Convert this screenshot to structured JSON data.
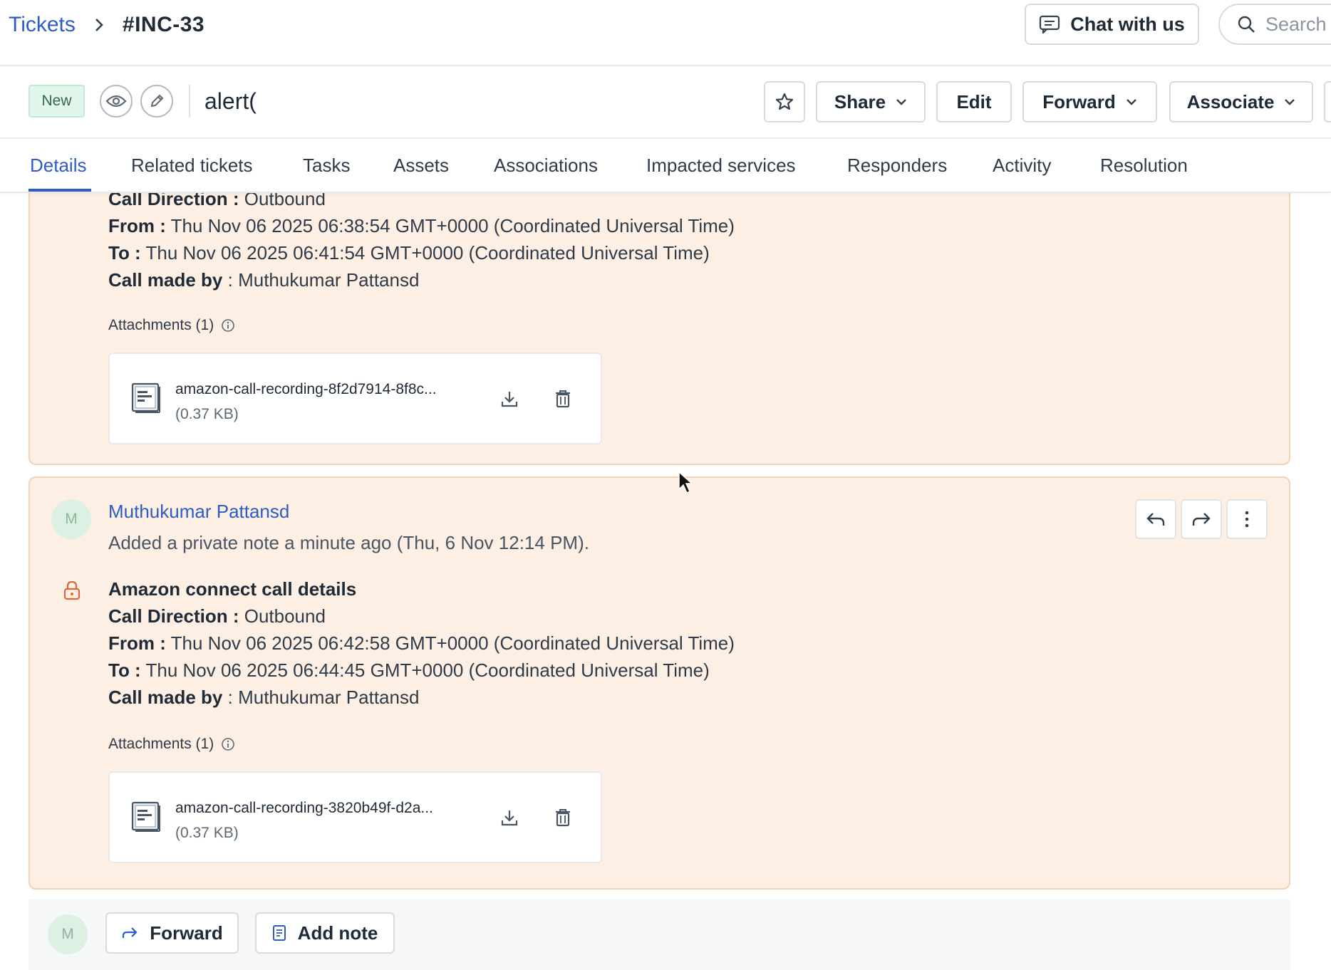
{
  "breadcrumb": {
    "root": "Tickets",
    "current": "#INC-33"
  },
  "header_actions": {
    "chat_label": "Chat with us",
    "search_placeholder": "Search"
  },
  "ticket": {
    "status": "New",
    "subject": "alert(",
    "toolbar": {
      "share": "Share",
      "edit": "Edit",
      "forward": "Forward",
      "associate": "Associate"
    }
  },
  "tabs": [
    {
      "label": "Details",
      "active": true
    },
    {
      "label": "Related tickets"
    },
    {
      "label": "Tasks"
    },
    {
      "label": "Assets"
    },
    {
      "label": "Associations"
    },
    {
      "label": "Impacted services"
    },
    {
      "label": "Responders"
    },
    {
      "label": "Activity"
    },
    {
      "label": "Resolution"
    }
  ],
  "notes": [
    {
      "call_direction_label": "Call Direction :",
      "call_direction": "Outbound",
      "from_label": "From :",
      "from": "Thu Nov 06 2025 06:38:54 GMT+0000 (Coordinated Universal Time)",
      "to_label": "To :",
      "to": "Thu Nov 06 2025 06:41:54 GMT+0000 (Coordinated Universal Time)",
      "made_by_label": "Call made by",
      "made_by": ": Muthukumar Pattansd",
      "attachments_label": "Attachments (1)",
      "attachment": {
        "name": "amazon-call-recording-8f2d7914-8f8c...",
        "size": "(0.37 KB)"
      }
    },
    {
      "avatar_initial": "M",
      "author": "Muthukumar Pattansd",
      "meta": "Added a private note a minute ago (Thu, 6 Nov 12:14 PM).",
      "title": "Amazon connect call details",
      "call_direction_label": "Call Direction :",
      "call_direction": "Outbound",
      "from_label": "From :",
      "from": "Thu Nov 06 2025 06:42:58 GMT+0000 (Coordinated Universal Time)",
      "to_label": "To :",
      "to": "Thu Nov 06 2025 06:44:45 GMT+0000 (Coordinated Universal Time)",
      "made_by_label": "Call made by",
      "made_by": ": Muthukumar Pattansd",
      "attachments_label": "Attachments (1)",
      "attachment": {
        "name": "amazon-call-recording-3820b49f-d2a...",
        "size": "(0.37 KB)"
      }
    }
  ],
  "reply_bar": {
    "avatar_initial": "M",
    "forward": "Forward",
    "add_note": "Add note"
  },
  "colors": {
    "accent": "#2c5cc5",
    "note_bg": "#fdefe3",
    "note_border": "#f4d2b5",
    "status_new_bg": "#e3f6ec"
  }
}
